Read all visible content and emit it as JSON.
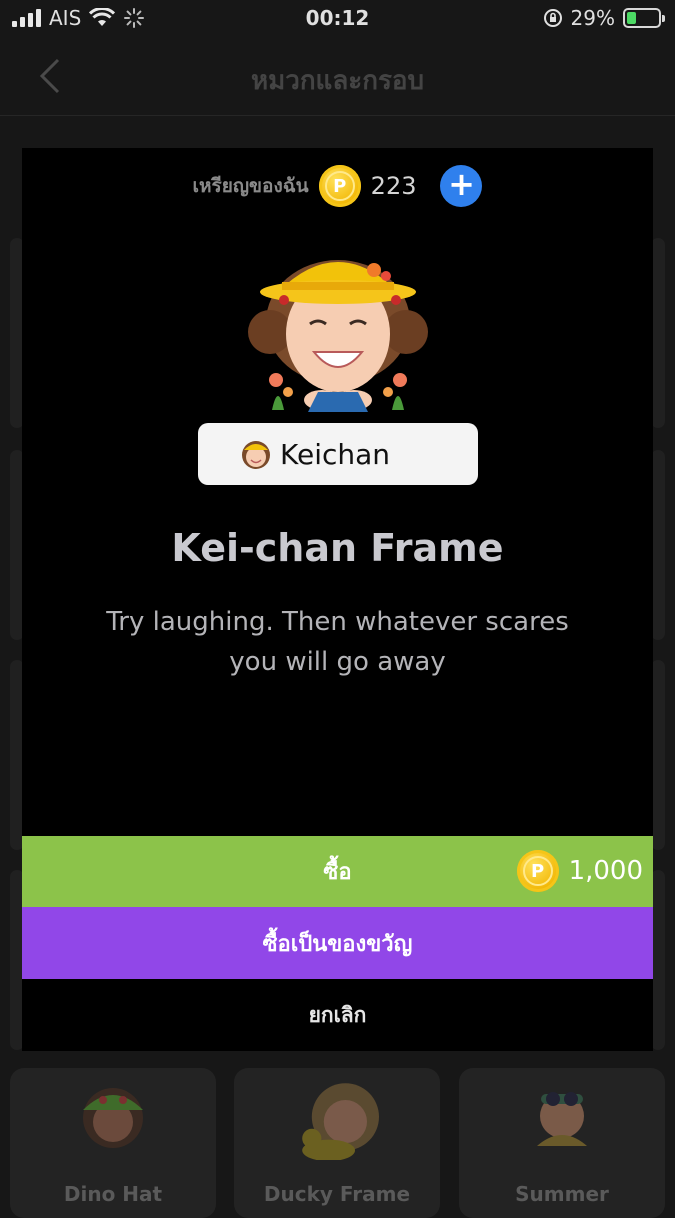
{
  "status_bar": {
    "carrier": "AIS",
    "time": "00:12",
    "battery_percent": "29%",
    "battery_level": 0.29
  },
  "header": {
    "title": "หมวกและกรอบ"
  },
  "modal": {
    "coins_label": "เหรียญของฉัน",
    "coin_symbol": "P",
    "coins_count": "223",
    "name_tag": "Keichan",
    "title": "Kei-chan Frame",
    "description": "Try laughing. Then whatever scares you will go away",
    "buy_label": "ซื้อ",
    "price": "1,000",
    "gift_label": "ซื้อเป็นของขวัญ",
    "cancel_label": "ยกเลิก"
  },
  "items": [
    {
      "label": "Dino Hat"
    },
    {
      "label": "Ducky Frame"
    },
    {
      "label": "Summer"
    }
  ],
  "colors": {
    "buy_green": "#8cc34a",
    "gift_purple": "#9147e8",
    "add_blue": "#2f80ed",
    "coin_gold": "#f2b705"
  }
}
